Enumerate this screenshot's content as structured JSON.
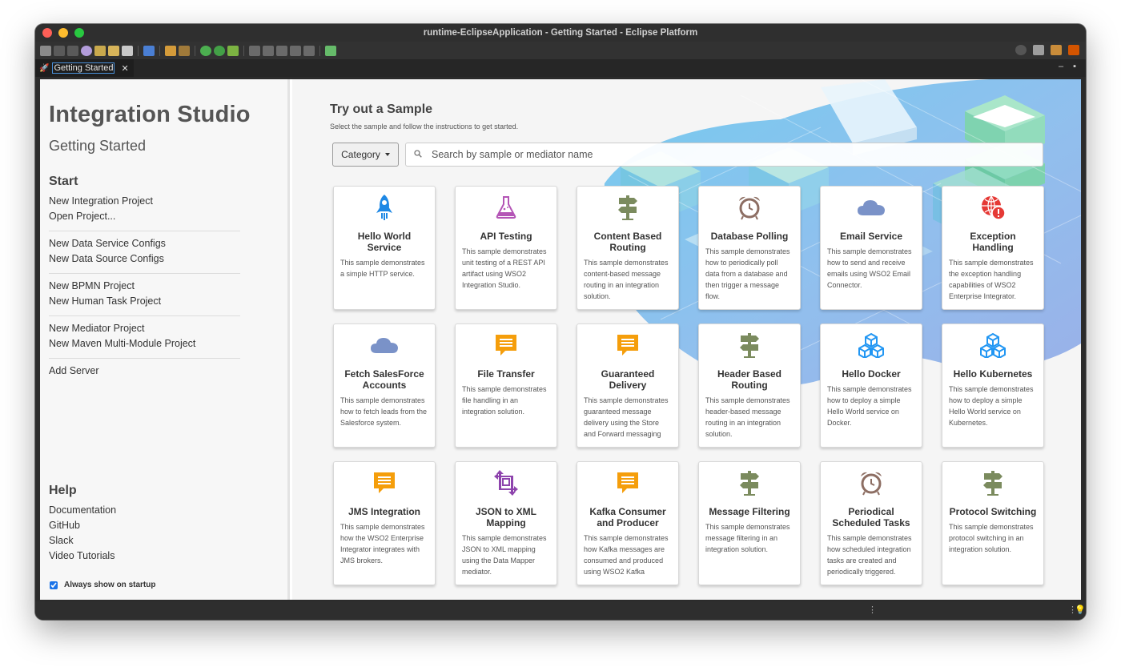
{
  "window": {
    "title": "runtime-EclipseApplication - Getting Started - Eclipse Platform",
    "tab_label": "Getting Started",
    "tab_close": "✕"
  },
  "sidebar": {
    "title": "Integration Studio",
    "subtitle": "Getting Started",
    "start_heading": "Start",
    "groups": [
      [
        "New Integration Project",
        "Open Project..."
      ],
      [
        "New Data Service Configs",
        "New Data Source Configs"
      ],
      [
        "New BPMN Project",
        "New Human Task Project"
      ],
      [
        "New Mediator Project",
        "New Maven Multi-Module Project"
      ],
      [
        "Add Server"
      ]
    ],
    "help_heading": "Help",
    "help_links": [
      "Documentation",
      "GitHub",
      "Slack",
      "Video Tutorials"
    ],
    "startup_label": "Always show on startup",
    "startup_checked": true
  },
  "main": {
    "title": "Try out a Sample",
    "subtitle": "Select the sample and follow the instructions to get started.",
    "category_label": "Category",
    "search_placeholder": "Search by sample or mediator name"
  },
  "colors": {
    "rocket": "#1e88e5",
    "flask": "#b455b6",
    "signpost": "#7b8b5e",
    "clock": "#8d6e63",
    "cloud": "#7a92c8",
    "globe": "#e53935",
    "message": "#f59e0b",
    "cubes": "#2196f3",
    "mapping": "#8e44ad"
  },
  "samples": [
    {
      "title": "Hello World Service",
      "icon": "rocket-icon",
      "desc": "This sample demonstrates a simple HTTP service."
    },
    {
      "title": "API Testing",
      "icon": "flask-icon",
      "desc": "This sample demonstrates unit testing of a REST API artifact using WSO2 Integration Studio."
    },
    {
      "title": "Content Based Routing",
      "icon": "signpost-icon",
      "desc": "This sample demonstrates content-based message routing in an integration solution."
    },
    {
      "title": "Database Polling",
      "icon": "alarm-clock-icon",
      "desc": "This sample demonstrates how to periodically poll data from a database and then trigger a message flow."
    },
    {
      "title": "Email Service",
      "icon": "cloud-icon",
      "desc": "This sample demonstrates how to send and receive emails using WSO2 Email Connector."
    },
    {
      "title": "Exception Handling",
      "icon": "globe-alert-icon",
      "desc": "This sample demonstrates the exception handling capabilities of WSO2 Enterprise Integrator."
    },
    {
      "title": "Fetch SalesForce Accounts",
      "icon": "cloud-icon",
      "desc": "This sample demonstrates how to fetch leads from the Salesforce system."
    },
    {
      "title": "File Transfer",
      "icon": "message-icon",
      "desc": "This sample demonstrates file handling in an integration solution."
    },
    {
      "title": "Guaranteed Delivery",
      "icon": "message-icon",
      "desc": "This sample demonstrates guaranteed message delivery using the Store and Forward messaging"
    },
    {
      "title": "Header Based Routing",
      "icon": "signpost-icon",
      "desc": "This sample demonstrates header-based message routing in an integration solution."
    },
    {
      "title": "Hello Docker",
      "icon": "cubes-icon",
      "desc": "This sample demonstrates how to deploy a simple Hello World service on Docker."
    },
    {
      "title": "Hello Kubernetes",
      "icon": "cubes-icon",
      "desc": "This sample demonstrates how to deploy a simple Hello World service on Kubernetes."
    },
    {
      "title": "JMS Integration",
      "icon": "message-icon",
      "desc": "This sample demonstrates how the WSO2 Enterprise Integrator integrates with JMS brokers."
    },
    {
      "title": "JSON to XML Mapping",
      "icon": "mapping-icon",
      "desc": "This sample demonstrates JSON to XML mapping using the Data Mapper mediator."
    },
    {
      "title": "Kafka Consumer and Producer",
      "icon": "message-icon",
      "desc": "This sample demonstrates how Kafka messages are consumed and produced using WSO2 Kafka"
    },
    {
      "title": "Message Filtering",
      "icon": "signpost-icon",
      "desc": "This sample demonstrates message filtering in an integration solution."
    },
    {
      "title": "Periodical Scheduled Tasks",
      "icon": "alarm-clock-icon",
      "desc": "This sample demonstrates how scheduled integration tasks are created and periodically triggered."
    },
    {
      "title": "Protocol Switching",
      "icon": "signpost-icon",
      "desc": "This sample demonstrates protocol switching in an integration solution."
    }
  ]
}
